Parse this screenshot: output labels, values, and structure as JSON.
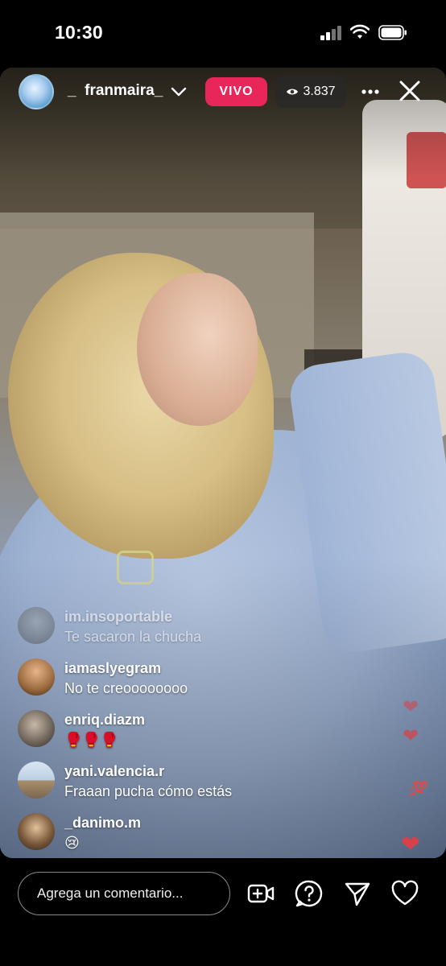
{
  "status_bar": {
    "time": "10:30"
  },
  "live_header": {
    "username": "_  franmaira_",
    "live_label": "VIVO",
    "viewer_count": "3.837"
  },
  "comments": [
    {
      "user": "im.insoportable",
      "text": "Te sacaron la chucha"
    },
    {
      "user": "iamaslyegram",
      "text": "No te creoooooooo"
    },
    {
      "user": "enriq.diazm",
      "text": "🥊🥊🥊"
    },
    {
      "user": "yani.valencia.r",
      "text": "Fraaan pucha cómo estás"
    },
    {
      "user": "_danimo.m",
      "text": "😢"
    }
  ],
  "reactions": {
    "hundred": "💯"
  },
  "bottom_bar": {
    "comment_placeholder": "Agrega un comentario..."
  },
  "icons": [
    "chevron-down-icon",
    "eye-icon",
    "more-icon",
    "close-icon",
    "add-video-icon",
    "question-icon",
    "send-icon",
    "heart-icon"
  ],
  "colors": {
    "live_badge": "#e8265a",
    "heart": "#d9414a",
    "background": "#000000"
  }
}
